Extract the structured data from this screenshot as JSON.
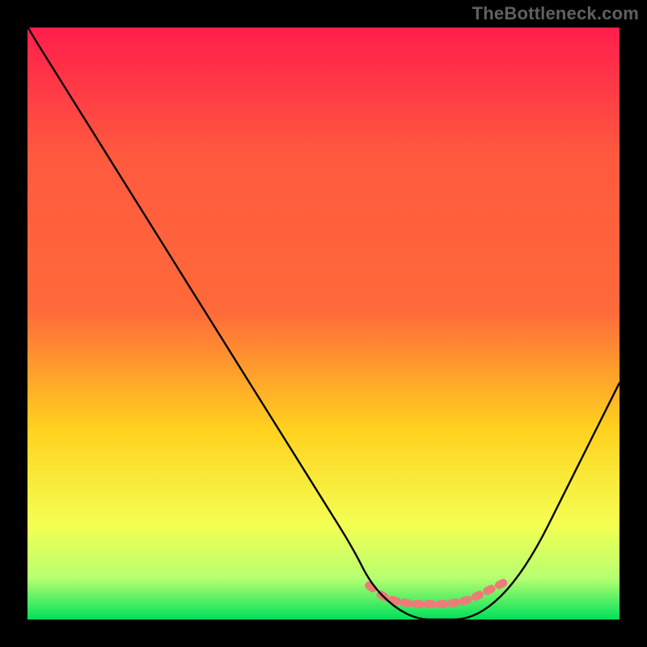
{
  "attribution": "TheBottleneck.com",
  "chart_data": {
    "type": "line",
    "title": "",
    "xlabel": "",
    "ylabel": "",
    "xlim": [
      0,
      100
    ],
    "ylim": [
      0,
      100
    ],
    "show_axes": false,
    "background_gradient": {
      "top": "#ff1e4c",
      "mid_upper": "#ff6a3a",
      "mid": "#ffd21e",
      "mid_lower": "#f4ff52",
      "near_bottom": "#b6ff70",
      "bottom": "#00e05a"
    },
    "series": [
      {
        "name": "bottleneck-curve",
        "color": "#000000",
        "x": [
          0,
          5,
          10,
          15,
          20,
          25,
          30,
          35,
          40,
          45,
          50,
          55,
          58,
          62,
          66,
          70,
          74,
          78,
          82,
          86,
          90,
          94,
          100
        ],
        "y": [
          100,
          92,
          84,
          76,
          68,
          60,
          52,
          44,
          36,
          28,
          20,
          12,
          6,
          2,
          0,
          0,
          0,
          2,
          6,
          12,
          20,
          28,
          40
        ]
      }
    ],
    "markers": {
      "name": "minimum-band",
      "color": "#ed7b78",
      "x": [
        58,
        60,
        62,
        64,
        66,
        68,
        70,
        72,
        74,
        76,
        78,
        80
      ],
      "y": [
        5.5,
        4.0,
        3.2,
        2.8,
        2.6,
        2.6,
        2.6,
        2.8,
        3.2,
        4.0,
        5.0,
        6.0
      ]
    }
  }
}
